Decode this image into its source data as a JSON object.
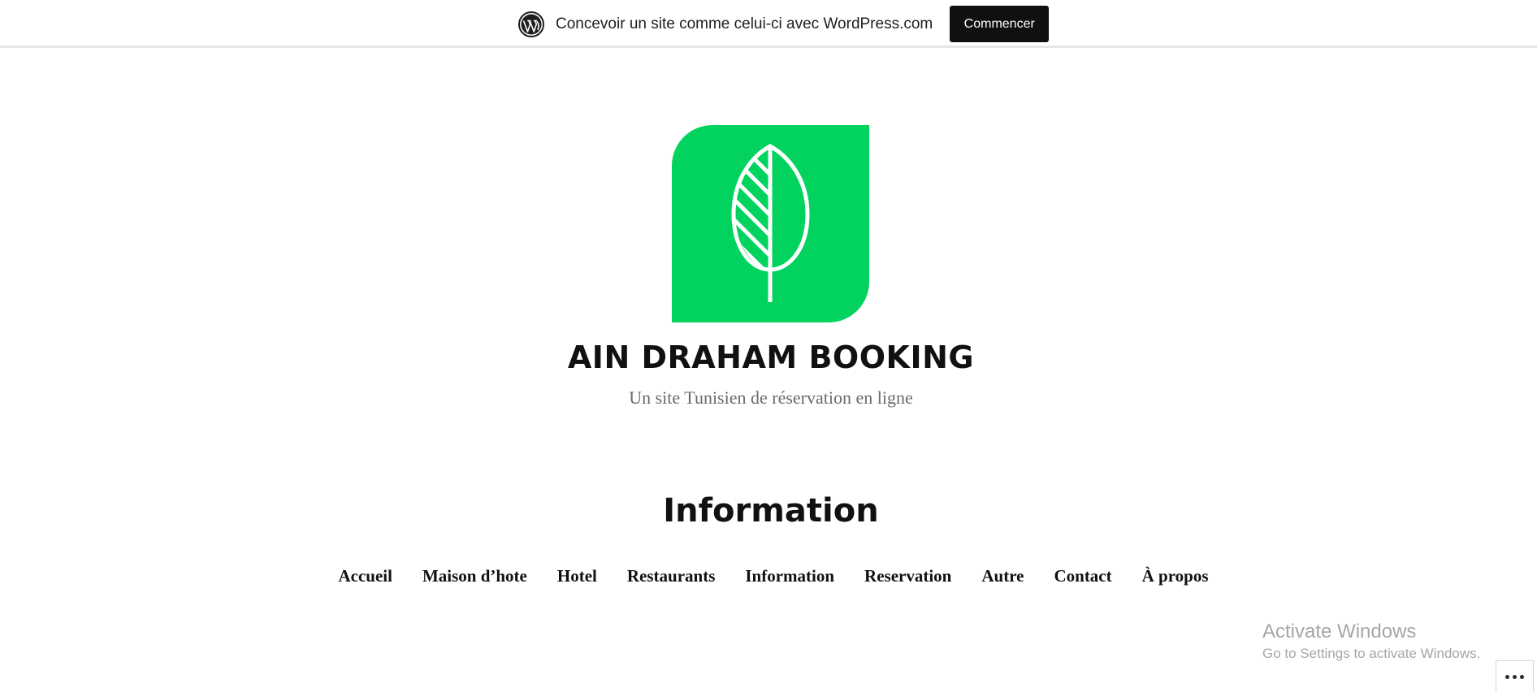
{
  "promo_bar": {
    "icon": "wordpress-logo-icon",
    "text": "Concevoir un site comme celui-ci avec WordPress.com",
    "button_label": "Commencer"
  },
  "site": {
    "logo_icon": "green-leaf-logo",
    "logo_color": "#02d35e",
    "title": "AIN DRAHAM BOOKING",
    "tagline": "Un site Tunisien de réservation en ligne"
  },
  "page": {
    "heading": "Information"
  },
  "nav": {
    "items": [
      {
        "label": "Accueil"
      },
      {
        "label": "Maison d’hote"
      },
      {
        "label": "Hotel"
      },
      {
        "label": "Restaurants"
      },
      {
        "label": "Information"
      },
      {
        "label": "Reservation"
      },
      {
        "label": "Autre"
      },
      {
        "label": "Contact"
      },
      {
        "label": "À propos"
      }
    ]
  },
  "watermark": {
    "title": "Activate Windows",
    "subtitle": "Go to Settings to activate Windows."
  },
  "more_button": {
    "icon": "ellipsis-icon"
  }
}
